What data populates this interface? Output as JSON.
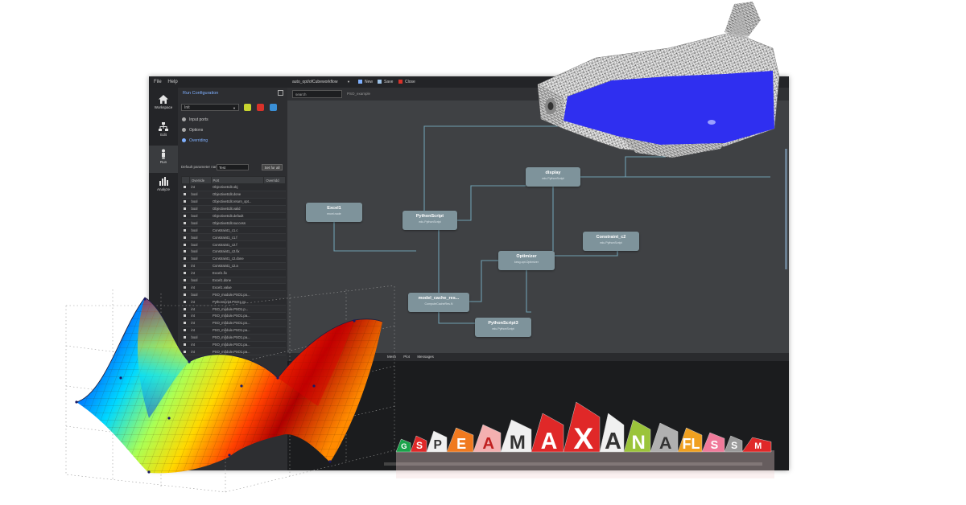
{
  "menu": {
    "file": "File",
    "help": "Help"
  },
  "nav": [
    {
      "label": "Workspace",
      "icon": "home-icon"
    },
    {
      "label": "Edit",
      "icon": "workflow-icon"
    },
    {
      "label": "Run",
      "icon": "run-icon"
    },
    {
      "label": "Analyze",
      "icon": "analyze-icon"
    }
  ],
  "run_panel": {
    "title": "Run Configuration",
    "config_select": "Init",
    "options": [
      "Input ports",
      "Options",
      "Overriding"
    ],
    "default_label": "Default parameter name:",
    "default_value": "Test",
    "set_button": "Set for all",
    "table": {
      "headers": [
        "",
        "Override",
        "Port",
        "Overridd"
      ],
      "rows": [
        [
          "int",
          "ObjectiveEdit.obj"
        ],
        [
          "bool",
          "ObjectiveEdit.done"
        ],
        [
          "bool",
          "ObjectiveEdit.return_opt..."
        ],
        [
          "bool",
          "ObjectiveEdit.valid"
        ],
        [
          "bool",
          "ObjectiveEdit.default"
        ],
        [
          "bool",
          "ObjectiveEdit.success"
        ],
        [
          "bool",
          "Constraint1_c1.c"
        ],
        [
          "bool",
          "Constraint1_c1.f"
        ],
        [
          "bool",
          "Constraint1_c2.f"
        ],
        [
          "bool",
          "Constraint1_c2.fix"
        ],
        [
          "bool",
          "Constraint1_c2.done"
        ],
        [
          "int",
          "Constraint1_c2.a"
        ],
        [
          "int",
          "Excel1.fix"
        ],
        [
          "bool",
          "Excel1.done"
        ],
        [
          "int",
          "Excel1.value"
        ],
        [
          "bool",
          "PSO_module.PSO1.po..."
        ],
        [
          "int",
          "Pythonscript.PSO1.po..."
        ],
        [
          "int",
          "PSO_module.PSO1.p..."
        ],
        [
          "int",
          "PSO_module.PSO1.pa..."
        ],
        [
          "int",
          "PSO_module.PSO1.po..."
        ],
        [
          "int",
          "PSO_module.PSO1.pa..."
        ],
        [
          "bool",
          "PSO_module.PSO1.pa..."
        ],
        [
          "int",
          "PSO_module.PSO1.pa..."
        ],
        [
          "int",
          "PSO_module.PSO1.pa..."
        ]
      ]
    }
  },
  "tabs": {
    "workflow": "auto_opt/ofCubeworkflow",
    "new": "New",
    "save": "Save",
    "close": "Close"
  },
  "canvas_toolbar": {
    "search_value": "search",
    "path": "PSO_example"
  },
  "nodes": [
    {
      "title": "Excel1",
      "subtitle": "excel.node"
    },
    {
      "title": "PythonScript",
      "subtitle": "edu.PythonScript"
    },
    {
      "title": "display",
      "subtitle": "edu.PythonScript"
    },
    {
      "title": "Constraint_c2",
      "subtitle": "edu.PythonScript"
    },
    {
      "title": "Optimizer",
      "subtitle": "kesg.opt.Optimizer"
    },
    {
      "title": "model_cache_res...",
      "subtitle": "ComputeCacheRes.N"
    },
    {
      "title": "PythonScript3",
      "subtitle": "edu.PythonScript"
    }
  ],
  "log_tabs": [
    "Mesh",
    "Plot",
    "Messages"
  ],
  "logo_letters": [
    "G",
    "S",
    "P",
    "E",
    "A",
    "M",
    "A",
    "X",
    "A",
    "N",
    "A",
    "FL",
    "S",
    "S",
    "M"
  ],
  "colors": {
    "accent": "#7fb0ff",
    "node": "#7e939b",
    "link": "#6f9fb1",
    "app_bg": "#3a3c3f",
    "mesh_highlight": "#2f2ff0"
  }
}
